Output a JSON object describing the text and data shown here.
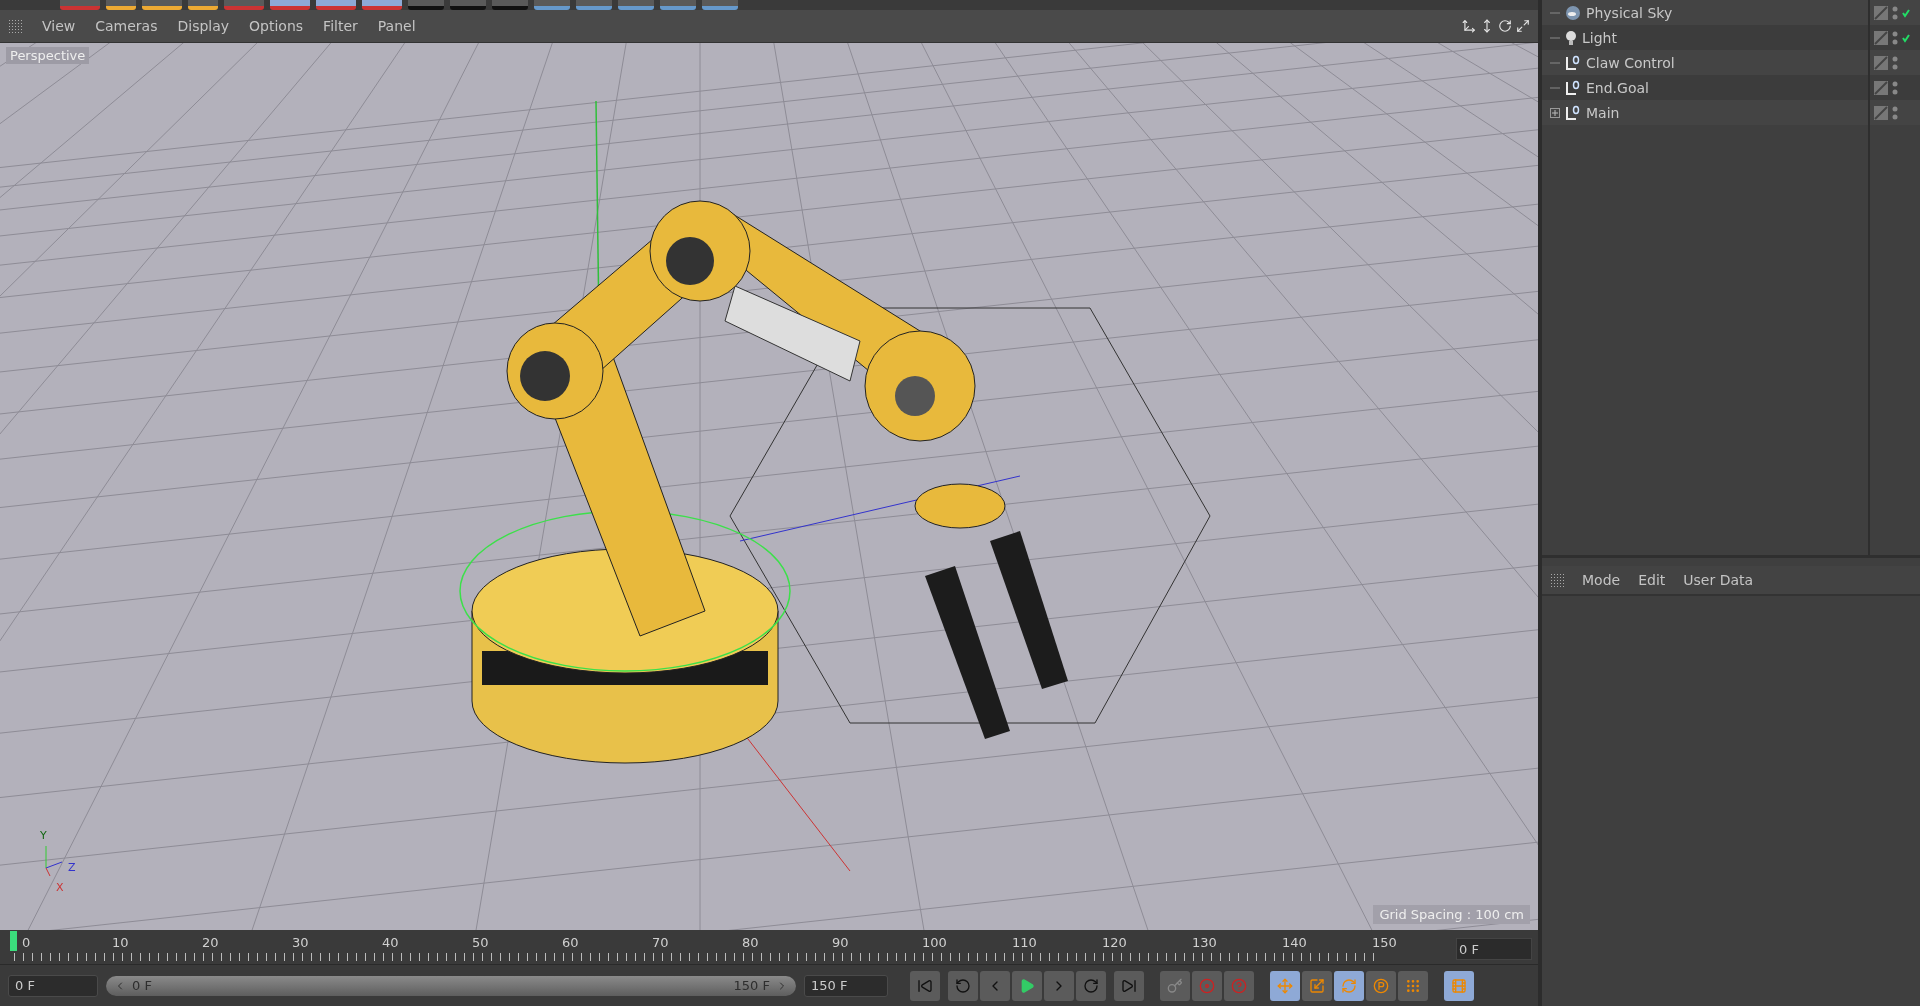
{
  "viewport": {
    "menu": [
      "View",
      "Cameras",
      "Display",
      "Options",
      "Filter",
      "Panel"
    ],
    "camera_label": "Perspective",
    "grid_spacing": "Grid Spacing : 100 cm",
    "axis_labels": [
      "Y",
      "Z",
      "X"
    ]
  },
  "objects": [
    {
      "name": "Physical Sky",
      "kind": "sky",
      "expandable": false,
      "checked": true
    },
    {
      "name": "Light",
      "kind": "light",
      "expandable": false,
      "checked": true
    },
    {
      "name": "Claw Control",
      "kind": "null",
      "expandable": false,
      "checked": false
    },
    {
      "name": "End.Goal",
      "kind": "null",
      "expandable": false,
      "checked": false
    },
    {
      "name": "Main",
      "kind": "null",
      "expandable": true,
      "checked": false
    }
  ],
  "attributes": {
    "menu": [
      "Mode",
      "Edit",
      "User Data"
    ]
  },
  "timeline": {
    "ticks": [
      "0",
      "10",
      "20",
      "30",
      "40",
      "50",
      "60",
      "70",
      "80",
      "90",
      "100",
      "110",
      "120",
      "130",
      "140",
      "150"
    ],
    "level": 0,
    "current_frame": "0 F"
  },
  "controls": {
    "start": "0 F",
    "range_start": "0 F",
    "range_end": "150 F",
    "end": "150 F"
  }
}
